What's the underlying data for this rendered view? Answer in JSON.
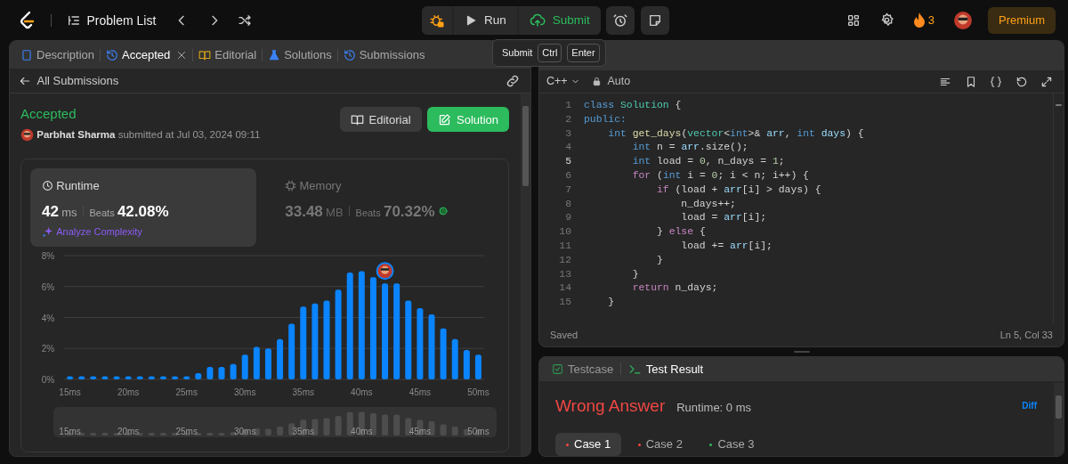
{
  "topbar": {
    "problem_list": "Problem List",
    "actions": [
      {
        "label": "Run",
        "kind": "run"
      },
      {
        "label": "Submit",
        "kind": "submit"
      }
    ],
    "streak": "3",
    "premium": "Premium"
  },
  "tooltip": {
    "label": "Submit",
    "keys": [
      "Ctrl",
      "Enter"
    ]
  },
  "left_panel": {
    "tabs": [
      {
        "label": "Description",
        "kind": "description",
        "selected": false,
        "closable": false
      },
      {
        "label": "Accepted",
        "kind": "history",
        "selected": true,
        "closable": true
      },
      {
        "label": "Editorial",
        "kind": "book",
        "selected": false,
        "closable": false
      },
      {
        "label": "Solutions",
        "kind": "flask",
        "selected": false,
        "closable": false
      },
      {
        "label": "Submissions",
        "kind": "history",
        "selected": false,
        "closable": false
      }
    ],
    "back": "All Submissions",
    "status": "Accepted",
    "author": "Parbhat Sharma",
    "submitted": "submitted at Jul 03, 2024 09:11",
    "buttons": [
      {
        "label": "Editorial",
        "kind": "editorial"
      },
      {
        "label": "Solution",
        "kind": "solution"
      }
    ],
    "metrics": [
      {
        "kind": "runtime",
        "title": "Runtime",
        "value": "42",
        "unit": "ms",
        "beats_label": "Beats",
        "beats": "42.08%",
        "selected": true,
        "link": "Analyze Complexity"
      },
      {
        "kind": "memory",
        "title": "Memory",
        "value": "33.48",
        "unit": "MB",
        "beats_label": "Beats",
        "beats": "70.32%",
        "selected": false
      }
    ],
    "chart_data": {
      "type": "bar",
      "x": [
        15,
        16,
        17,
        18,
        19,
        20,
        21,
        22,
        23,
        24,
        25,
        26,
        27,
        28,
        29,
        30,
        31,
        32,
        33,
        34,
        35,
        36,
        37,
        38,
        39,
        40,
        41,
        42,
        43,
        44,
        45,
        46,
        47,
        48,
        49,
        50
      ],
      "series": [
        {
          "color": "#0a84ff",
          "values": [
            0.2,
            0.2,
            0.2,
            0.2,
            0.2,
            0.2,
            0.2,
            0.2,
            0.2,
            0.2,
            0.2,
            0.4,
            0.8,
            0.8,
            1.0,
            1.6,
            2.1,
            2.0,
            2.6,
            3.6,
            4.7,
            4.9,
            5.1,
            5.8,
            6.9,
            7.0,
            6.6,
            6.2,
            6.2,
            5.1,
            4.6,
            4.2,
            3.3,
            2.6,
            1.9,
            1.6
          ]
        }
      ],
      "xlim": [
        14.5,
        50.5
      ],
      "ylim": [
        0,
        8
      ],
      "grid": true,
      "xticks": [
        {
          "value": 15,
          "label": "15ms"
        },
        {
          "value": 20,
          "label": "20ms"
        },
        {
          "value": 25,
          "label": "25ms"
        },
        {
          "value": 30,
          "label": "30ms"
        },
        {
          "value": 35,
          "label": "35ms"
        },
        {
          "value": 40,
          "label": "40ms"
        },
        {
          "value": 45,
          "label": "45ms"
        },
        {
          "value": 50,
          "label": "50ms"
        }
      ],
      "yticks": [
        {
          "value": 0,
          "label": "0%"
        },
        {
          "value": 2,
          "label": "2%"
        },
        {
          "value": 4,
          "label": "4%"
        },
        {
          "value": 6,
          "label": "6%"
        },
        {
          "value": 8,
          "label": "8%"
        }
      ]
    },
    "overview": {
      "ticks": [
        "15ms",
        "20ms",
        "25ms",
        "30ms",
        "35ms",
        "40ms",
        "45ms",
        "50ms"
      ]
    }
  },
  "editor": {
    "language": "C++",
    "mode": "Auto",
    "lines": [
      {
        "number": "1",
        "current": false,
        "tokens": [
          {
            "text": "class",
            "kind": "keyword"
          },
          {
            "text": " Solution",
            "kind": "type"
          },
          {
            "text": " {",
            "kind": "plain"
          }
        ]
      },
      {
        "number": "2",
        "current": false,
        "tokens": [
          {
            "text": "public:",
            "kind": "keyword"
          }
        ]
      },
      {
        "number": "3",
        "current": false,
        "tokens": [
          {
            "text": "    int",
            "kind": "keyword"
          },
          {
            "text": " get_days",
            "kind": "function"
          },
          {
            "text": "(",
            "kind": "plain"
          },
          {
            "text": "vector",
            "kind": "type"
          },
          {
            "text": "<",
            "kind": "plain"
          },
          {
            "text": "int",
            "kind": "keyword"
          },
          {
            "text": ">& ",
            "kind": "plain"
          },
          {
            "text": "arr",
            "kind": "variable"
          },
          {
            "text": ", ",
            "kind": "plain"
          },
          {
            "text": "int",
            "kind": "keyword"
          },
          {
            "text": " days",
            "kind": "variable"
          },
          {
            "text": ") {",
            "kind": "plain"
          }
        ]
      },
      {
        "number": "4",
        "current": false,
        "tokens": [
          {
            "text": "        int",
            "kind": "keyword"
          },
          {
            "text": " n = ",
            "kind": "plain"
          },
          {
            "text": "arr",
            "kind": "variable"
          },
          {
            "text": ".size();",
            "kind": "plain"
          }
        ]
      },
      {
        "number": "5",
        "current": true,
        "tokens": [
          {
            "text": "        int",
            "kind": "keyword"
          },
          {
            "text": " load = ",
            "kind": "plain"
          },
          {
            "text": "0",
            "kind": "number"
          },
          {
            "text": ", n_days = ",
            "kind": "plain"
          },
          {
            "text": "1",
            "kind": "number"
          },
          {
            "text": ";",
            "kind": "plain"
          }
        ]
      },
      {
        "number": "6",
        "current": false,
        "tokens": [
          {
            "text": "        for",
            "kind": "control"
          },
          {
            "text": " (",
            "kind": "plain"
          },
          {
            "text": "int",
            "kind": "keyword"
          },
          {
            "text": " i = ",
            "kind": "plain"
          },
          {
            "text": "0",
            "kind": "number"
          },
          {
            "text": "; i < n; i++) {",
            "kind": "plain"
          }
        ]
      },
      {
        "number": "7",
        "current": false,
        "tokens": [
          {
            "text": "            if",
            "kind": "control"
          },
          {
            "text": " (load + ",
            "kind": "plain"
          },
          {
            "text": "arr",
            "kind": "variable"
          },
          {
            "text": "[i] > days) {",
            "kind": "plain"
          }
        ]
      },
      {
        "number": "8",
        "current": false,
        "tokens": [
          {
            "text": "                n_days++;",
            "kind": "plain"
          }
        ]
      },
      {
        "number": "9",
        "current": false,
        "tokens": [
          {
            "text": "                load = ",
            "kind": "plain"
          },
          {
            "text": "arr",
            "kind": "variable"
          },
          {
            "text": "[i];",
            "kind": "plain"
          }
        ]
      },
      {
        "number": "10",
        "current": false,
        "tokens": [
          {
            "text": "            } ",
            "kind": "plain"
          },
          {
            "text": "else",
            "kind": "control"
          },
          {
            "text": " {",
            "kind": "plain"
          }
        ]
      },
      {
        "number": "11",
        "current": false,
        "tokens": [
          {
            "text": "                load += ",
            "kind": "plain"
          },
          {
            "text": "arr",
            "kind": "variable"
          },
          {
            "text": "[i];",
            "kind": "plain"
          }
        ]
      },
      {
        "number": "12",
        "current": false,
        "tokens": [
          {
            "text": "            }",
            "kind": "plain"
          }
        ]
      },
      {
        "number": "13",
        "current": false,
        "tokens": [
          {
            "text": "        }",
            "kind": "plain"
          }
        ]
      },
      {
        "number": "14",
        "current": false,
        "tokens": [
          {
            "text": "        return",
            "kind": "control"
          },
          {
            "text": " n_days;",
            "kind": "plain"
          }
        ]
      },
      {
        "number": "15",
        "current": false,
        "tokens": [
          {
            "text": "    }",
            "kind": "plain"
          }
        ]
      }
    ],
    "status": "Saved",
    "cursor": "Ln 5, Col 33"
  },
  "results": {
    "tabs": [
      {
        "label": "Testcase",
        "kind": "testcase",
        "selected": false
      },
      {
        "label": "Test Result",
        "kind": "result",
        "selected": true
      }
    ],
    "verdict": "Wrong Answer",
    "runtime": "Runtime: 0 ms",
    "diff": "Diff",
    "cases": [
      {
        "label": "Case 1",
        "color": "#ef4743",
        "selected": true
      },
      {
        "label": "Case 2",
        "color": "#ef4743",
        "selected": false
      },
      {
        "label": "Case 3",
        "color": "#2cbb5d",
        "selected": false
      }
    ]
  }
}
